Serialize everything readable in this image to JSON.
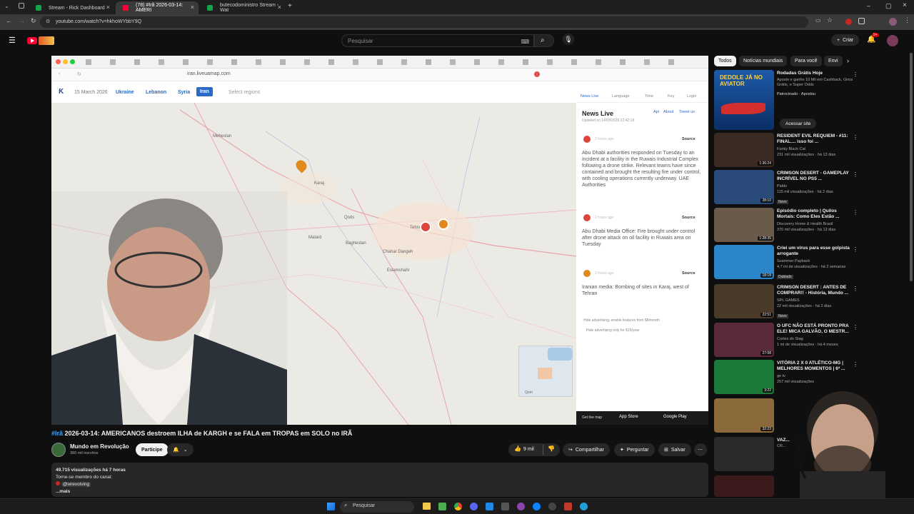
{
  "tabs": [
    {
      "label": "Stream - Rick Dashboard",
      "favicon_color": "#16a34a"
    },
    {
      "label": "(78) #Irã 2026-03-14: AMERI",
      "favicon_color": "#ff0033"
    },
    {
      "label": "butecodoministro Stream - Wat",
      "favicon_color": "#16a34a"
    }
  ],
  "address": {
    "url": "youtube.com/watch?v=hkhoWYbbY9Q"
  },
  "yt": {
    "search_placeholder": "Pesquisar",
    "create_label": "Criar",
    "notif_count": "9+"
  },
  "video_browser": {
    "url": "iran.liveuamap.com",
    "map_date": "15 March 2026",
    "region_tabs": [
      "Ukraine",
      "Lebanon",
      "Syria",
      "Iran"
    ],
    "select_regions": "Select regions",
    "panel_tabs": [
      "News Live",
      "Language",
      "Time",
      "Key",
      "Login"
    ],
    "news_title": "News Live",
    "news_links": [
      "Api",
      "About",
      "Tweet us"
    ],
    "updated": "Updated on 14/03/2026 22:42:18",
    "news": [
      {
        "time": "2 hours ago",
        "source": "Source",
        "text": "Abu Dhabi authorities responded on Tuesday to an incident at a facility in the Ruwais Industrial Complex following a drone strike. Relevant teams have since contained and brought the resulting fire under control, with cooling operations currently underway. UAE Authorities",
        "color": "#d9483b"
      },
      {
        "time": "2 hours ago",
        "source": "Source",
        "text": "Abu Dhabi Media Office: Fire brought under control after drone attack on oil facility in Ruwais area on Tuesday",
        "color": "#d9483b"
      },
      {
        "time": "3 hours ago",
        "source": "Source",
        "text": "Iranian media: Bombing of sites in Karaj, west of Tehran",
        "color": "#e08a1e"
      }
    ],
    "ads1": "Hide advertising, enable features from $8/month",
    "ads2": "Hide advertising only for $15/year",
    "get_live_map": "Get live map",
    "app_store": "App Store",
    "google_play": "Google Play",
    "map_places": [
      "Mehestan",
      "Karaj",
      "Qods",
      "Malard",
      "Baghestan",
      "Tehran",
      "Chahar Dangeh",
      "Eslamshahr",
      "Qom"
    ]
  },
  "video": {
    "title_hashtag": "#Irã",
    "title": " 2026-03-14: AMERICANOS destroem ILHA de KARGH e se FALA em TROPAS em SOLO no IRÃ",
    "channel": "Mundo em Revolução",
    "subs": "380 mil inscritos",
    "join": "Participe",
    "likes": "9 mil",
    "share": "Compartilhar",
    "ask": "Perguntar",
    "save": "Salvar",
    "views_line": "49.715 visualizações  há 7 horas",
    "desc_line1": "Torne-se membro do canal:",
    "desc_handle": "@wrevolving",
    "more": "...mais"
  },
  "chips": [
    "Todos",
    "Notícias mundiais",
    "Para você",
    "Envi"
  ],
  "ad": {
    "title": "Rodadas Grátis Hoje",
    "text": "Aposte e ganhe 10 Mil em Cashback, Giros Grátis, e Super Odds",
    "sponsored": "Patrocinado · Apostou",
    "cta": "Acessar site",
    "thumb_text": "DEDOLE JÁ NO AVIATOR"
  },
  "recs": [
    {
      "title": "RESIDENT EVIL REQUIEM - #11: FINAL.... isso foi ...",
      "channel": "Funky Black Cat",
      "meta": "231 mil visualizações · há 13 dias",
      "dur": "1:36:24",
      "thumb": "#3a2a22"
    },
    {
      "title": "CRIMSON DESERT - GAMEPLAY INCRÍVEL NO PS5 ...",
      "channel": "Pablo",
      "meta": "115 mil visualizações · há 2 dias",
      "dur": "28:10",
      "thumb": "#2a4a7a",
      "badge": "Novo"
    },
    {
      "title": "Episódio completo | Quilos Mortais: Como Eles Estão ...",
      "channel": "Discovery Home & Health Brasil",
      "meta": "370 mil visualizações · há 13 dias",
      "dur": "1:28:35",
      "thumb": "#6a5a4a"
    },
    {
      "title": "Criei um vírus para esse golpista arrogante",
      "channel": "Scammer Payback",
      "meta": "4,7 mi de visualizações · há 2 semanas",
      "dur": "18:18",
      "thumb": "#2a86c8",
      "badge": "Dublado"
    },
    {
      "title": "CRIMSON DESERT : ANTES DE COMPRAR!! - História, Mundo ...",
      "channel": "SPL GAMES",
      "meta": "22 mil visualizações · há 2 dias",
      "dur": "22:51",
      "thumb": "#4a3a2a",
      "badge": "Novo"
    },
    {
      "title": "O UFC NÃO ESTÁ PRONTO PRA ELE! MICA GALVÃO, O MESTR...",
      "channel": "Cortes do Stag",
      "meta": "1 mi de visualizações · há 4 meses",
      "dur": "27:08",
      "thumb": "#5a2a3a"
    },
    {
      "title": "VITÓRIA 2 X 0 ATLÉTICO-MG | MELHORES MOMENTOS | 6ª ...",
      "channel": "ge tv",
      "meta": "257 mil visualizações",
      "dur": "3:22",
      "thumb": "#1a7a3a"
    },
    {
      "title": "",
      "channel": "",
      "meta": "",
      "dur": "32:23",
      "thumb": "#8a6a3a"
    },
    {
      "title": "VAZ...",
      "channel": "CR...",
      "meta": "",
      "dur": "",
      "thumb": "#2a2a2a"
    }
  ],
  "taskbar": {
    "search": "Pesquisar"
  }
}
